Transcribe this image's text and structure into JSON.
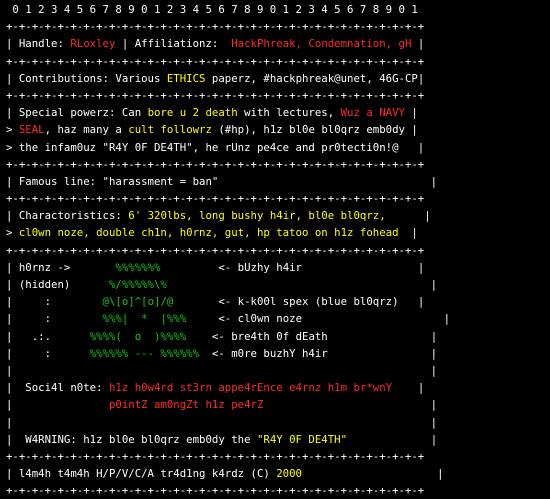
{
  "lines": [
    [
      {
        "t": " 0 1 2 3 4 5 6 7 8 9 0 1 2 3 4 5 6 7 8 9 0 1 2 3 4 5 6 7 8 9 0 1",
        "c": "w"
      }
    ],
    [
      {
        "t": "+-+-+-+-+-+-+-+-+-+-+-+-+-+-+-+-+-+-+-+-+-+-+-+-+-+-+-+-+-+-+-+-+",
        "c": "w"
      }
    ],
    [
      {
        "t": "| Handle: ",
        "c": "w"
      },
      {
        "t": "RLoxley",
        "c": "r"
      },
      {
        "t": " | Affiliationz:  ",
        "c": "w"
      },
      {
        "t": "HackPhreak, Condemnation, gH",
        "c": "r"
      },
      {
        "t": " |",
        "c": "w"
      }
    ],
    [
      {
        "t": "+-+-+-+-+-+-+-+-+-+-+-+-+-+-+-+-+-+-+-+-+-+-+-+-+-+-+-+-+-+-+-+-+",
        "c": "w"
      }
    ],
    [
      {
        "t": "| Contributions: Various ",
        "c": "w"
      },
      {
        "t": "ETHICS",
        "c": "y"
      },
      {
        "t": " paperz, #hackphreak@unet, 46G-CP|",
        "c": "w"
      }
    ],
    [
      {
        "t": "+-+-+-+-+-+-+-+-+-+-+-+-+-+-+-+-+-+-+-+-+-+-+-+-+-+-+-+-+-+-+-+-+",
        "c": "w"
      }
    ],
    [
      {
        "t": "| Special powerz: Can ",
        "c": "w"
      },
      {
        "t": "bore u 2 death",
        "c": "y"
      },
      {
        "t": " with lectures, ",
        "c": "w"
      },
      {
        "t": "Wuz a NAVY",
        "c": "r"
      },
      {
        "t": " |",
        "c": "w"
      }
    ],
    [
      {
        "t": "> ",
        "c": "w"
      },
      {
        "t": "SEAL",
        "c": "r"
      },
      {
        "t": ", haz many a ",
        "c": "w"
      },
      {
        "t": "cult followrz",
        "c": "y"
      },
      {
        "t": " (#hp), h1z bl0e bl0qrz emb0dy |",
        "c": "w"
      }
    ],
    [
      {
        "t": "> the infam0uz \"R4Y 0F DE4TH\", he rUnz pe4ce and pr0tecti0n!@   |",
        "c": "w"
      }
    ],
    [
      {
        "t": "+-+-+-+-+-+-+-+-+-+-+-+-+-+-+-+-+-+-+-+-+-+-+-+-+-+-+-+-+-+-+-+-+",
        "c": "w"
      }
    ],
    [
      {
        "t": "| Famous line: \"harassment = ban\"                                 |",
        "c": "w"
      }
    ],
    [
      {
        "t": "+-+-+-+-+-+-+-+-+-+-+-+-+-+-+-+-+-+-+-+-+-+-+-+-+-+-+-+-+-+-+-+-+",
        "c": "w"
      }
    ],
    [
      {
        "t": "| Charactoristics: ",
        "c": "w"
      },
      {
        "t": "6' 320lbs, long bushy h4ir, bl0e bl0qrz,",
        "c": "y"
      },
      {
        "t": "      |",
        "c": "w"
      }
    ],
    [
      {
        "t": "> ",
        "c": "w"
      },
      {
        "t": "cl0wn noze, double ch1n, h0rnz, gut, hp tatoo on h1z fohead",
        "c": "y"
      },
      {
        "t": "  |",
        "c": "w"
      }
    ],
    [
      {
        "t": "+-+-+-+-+-+-+-+-+-+-+-+-+-+-+-+-+-+-+-+-+-+-+-+-+-+-+-+-+-+-+-+-+",
        "c": "w"
      }
    ],
    [
      {
        "t": "| h0rnz ->       ",
        "c": "w"
      },
      {
        "t": "%%%%%%%",
        "c": "g"
      },
      {
        "t": "         <- bUzhy h4ir                  |",
        "c": "w"
      }
    ],
    [
      {
        "t": "| (hidden)      ",
        "c": "w"
      },
      {
        "t": "%/%%%%%\\%",
        "c": "g"
      },
      {
        "t": "                                         |",
        "c": "w"
      }
    ],
    [
      {
        "t": "|     :        ",
        "c": "w"
      },
      {
        "t": "@\\[o]^[o]/@",
        "c": "g"
      },
      {
        "t": "       <- k-k00l spex (blue bl0qrz)   |",
        "c": "w"
      }
    ],
    [
      {
        "t": "|     :        ",
        "c": "w"
      },
      {
        "t": "%%%|  *  |%%%",
        "c": "g"
      },
      {
        "t": "     <- cl0wn noze                      |",
        "c": "w"
      }
    ],
    [
      {
        "t": "|   .:.      ",
        "c": "w"
      },
      {
        "t": "%%%%(  o  )%%%%",
        "c": "g"
      },
      {
        "t": "    <- bre4th 0f dEath                |",
        "c": "w"
      }
    ],
    [
      {
        "t": "|     :      ",
        "c": "w"
      },
      {
        "t": "%%%%%% --- %%%%%%",
        "c": "g"
      },
      {
        "t": "  <- m0re buzhY h4ir                |",
        "c": "w"
      }
    ],
    [
      {
        "t": "|                                                                 |",
        "c": "w"
      }
    ],
    [
      {
        "t": "|  Soci4l n0te: ",
        "c": "w"
      },
      {
        "t": "h1z h0w4rd st3rn appe4rEnce e4rnz h1m br*wnY",
        "c": "r"
      },
      {
        "t": "    |",
        "c": "w"
      }
    ],
    [
      {
        "t": "|               ",
        "c": "w"
      },
      {
        "t": "p0intZ am0ngZt h1z pe4rZ",
        "c": "r"
      },
      {
        "t": "                          |",
        "c": "w"
      }
    ],
    [
      {
        "t": "|                                                                 |",
        "c": "w"
      }
    ],
    [
      {
        "t": "|  W4RNING: h1z bl0e bl0qrz emb0dy the ",
        "c": "w"
      },
      {
        "t": "\"R4Y 0F DE4TH\"",
        "c": "y"
      },
      {
        "t": "             |",
        "c": "w"
      }
    ],
    [
      {
        "t": "+-+-+-+-+-+-+-+-+-+-+-+-+-+-+-+-+-+-+-+-+-+-+-+-+-+-+-+-+-+-+-+-+",
        "c": "w"
      }
    ],
    [
      {
        "t": "| l4m4h t4m4h H/P/V/C/A tr4d1ng k4rdz (C) ",
        "c": "w"
      },
      {
        "t": "2000",
        "c": "y"
      },
      {
        "t": "                     |",
        "c": "w"
      }
    ],
    [
      {
        "t": "+-+-+-+-+-+-+-+-+-+-+-+-+-+-+-+-+-+-+-+-+-+-+-+-+-+-+-+-+-+-+-+-+",
        "c": "w"
      }
    ]
  ],
  "colors": {
    "w": "#ffffff",
    "r": "#ff2a2a",
    "y": "#ffff00",
    "g": "#18c418",
    "bg": "#000000"
  }
}
